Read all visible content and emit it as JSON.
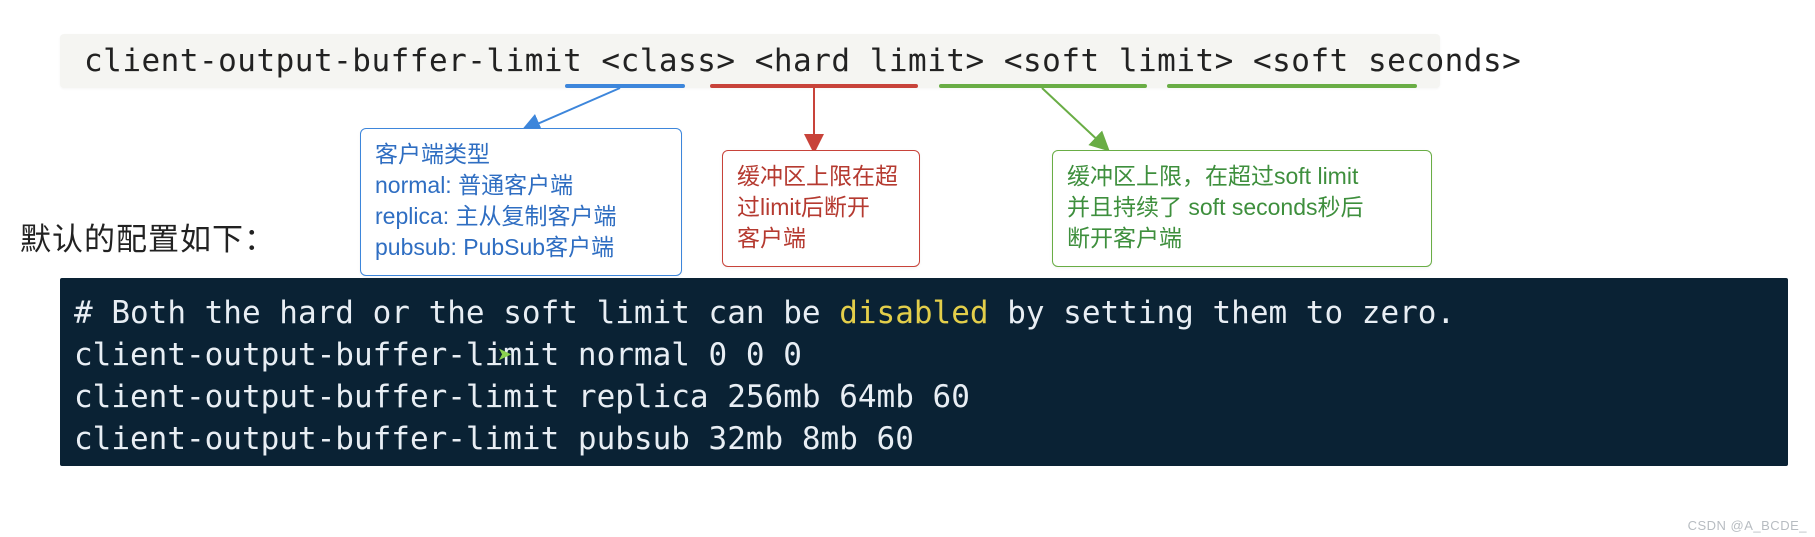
{
  "syntax": {
    "line": "client-output-buffer-limit <class> <hard limit> <soft limit> <soft seconds>"
  },
  "callouts": {
    "class": {
      "l1": "客户端类型",
      "l2": "normal: 普通客户端",
      "l3": "replica: 主从复制客户端",
      "l4": "pubsub: PubSub客户端"
    },
    "hard": {
      "l1": "缓冲区上限在超",
      "l2": "过limit后断开",
      "l3": "客户端"
    },
    "soft": {
      "l1": "缓冲区上限，在超过soft limit",
      "l2": "并且持续了 soft seconds秒后",
      "l3": "断开客户端"
    }
  },
  "labels": {
    "default_config": "默认的配置如下："
  },
  "code": {
    "comment_before": "# Both the hard or the soft limit can be ",
    "comment_kw": "disabled",
    "comment_after": " by setting them to zero.",
    "line2": "client-output-buffer-limit normal 0 0 0",
    "line3": "client-output-buffer-limit replica 256mb 64mb 60",
    "line4": "client-output-buffer-limit pubsub 32mb 8mb 60"
  },
  "watermark": "CSDN @A_BCDE_",
  "colors": {
    "blue": "#3d86db",
    "red": "#c8433a",
    "green": "#69ad45",
    "code_bg": "#0a2234",
    "highlight": "#e3ce4a"
  }
}
